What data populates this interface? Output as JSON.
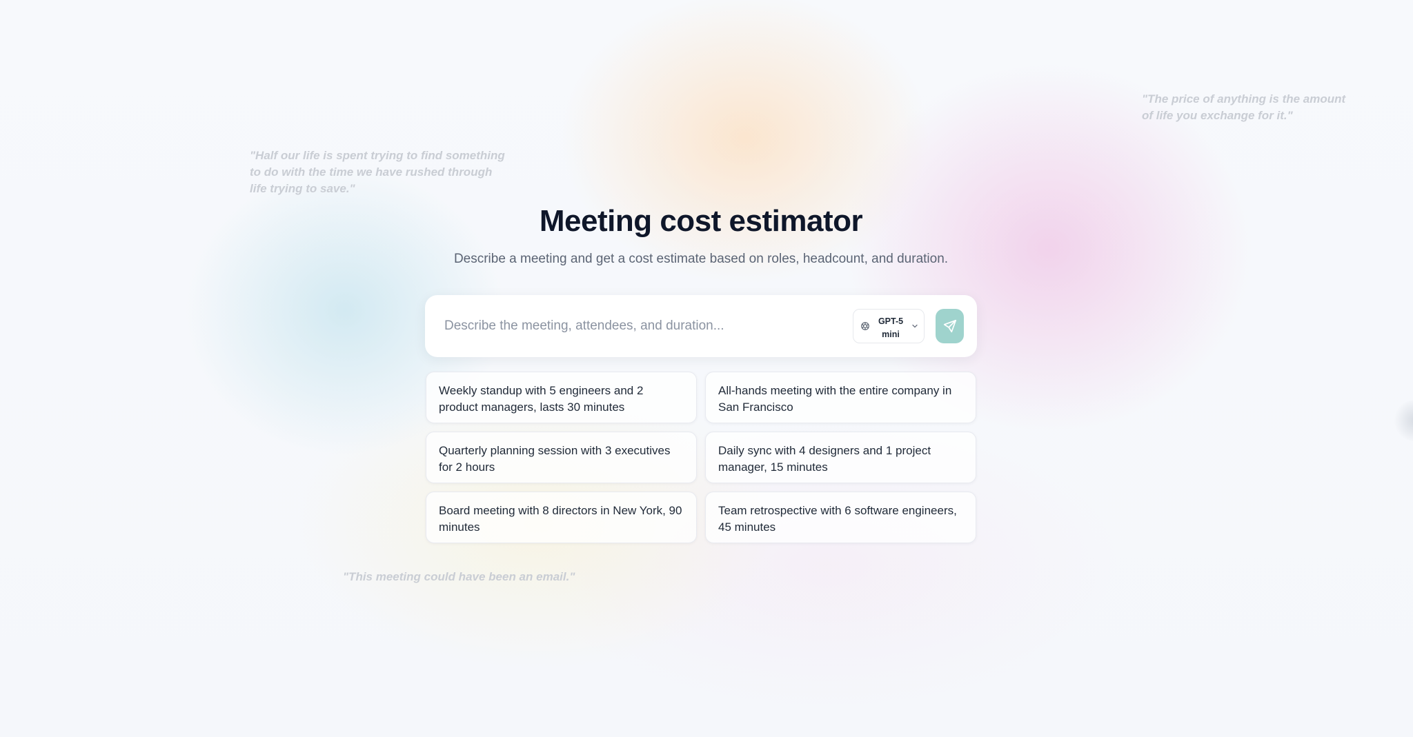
{
  "page": {
    "title": "Meeting cost estimator",
    "subtitle": "Describe a meeting and get a cost estimate based on roles, headcount, and duration."
  },
  "quotes": [
    "\"Half our life is spent trying to find something to do with the time we have rushed through life trying to save.\"",
    "\"The price of anything is the amount of life you exchange for it.\"",
    "\"This meeting could have been an email.\""
  ],
  "input": {
    "placeholder": "Describe the meeting, attendees, and duration...",
    "value": ""
  },
  "model_selector": {
    "label": "GPT-5 mini",
    "icon": "openai-icon"
  },
  "send_button": {
    "icon": "send-icon",
    "color": "#9fd3cd"
  },
  "suggestions": [
    "Weekly standup with 5 engineers and 2 product managers, lasts 30 minutes",
    "All-hands meeting with the entire company in San Francisco",
    "Quarterly planning session with 3 executives for 2 hours",
    "Daily sync with 4 designers and 1 project manager, 15 minutes",
    "Board meeting with 8 directors in New York, 90 minutes",
    "Team retrospective with 6 software engineers, 45 minutes"
  ]
}
